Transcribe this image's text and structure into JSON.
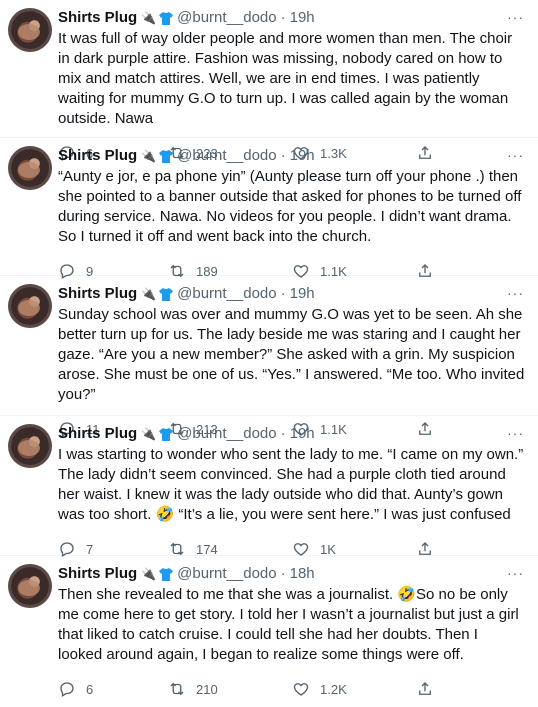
{
  "tweets": [
    {
      "name": "Shirts Plug",
      "emoji": "🔌",
      "handle": "@burnt__dodo",
      "time": "19h",
      "text": "It was full of way older people and more women than men. The choir in dark purple attire. Fashion was missing, nobody cared on how to mix and match attires. Well, we are in end times. I was patiently waiting for mummy G.O to turn up. I was called again by the woman outside. Nawa",
      "replies": "6",
      "retweets": "223",
      "likes": "1.3K"
    },
    {
      "name": "Shirts Plug",
      "emoji": "🔌",
      "handle": "@burnt__dodo",
      "time": "19h",
      "text": "“Aunty e jor, e pa phone yin” (Aunty please turn off your phone .) then she pointed to a banner outside that asked for phones to be turned off during service. Nawa. No videos for you people. I didn’t want drama. So I turned it off and went back into the church.",
      "replies": "9",
      "retweets": "189",
      "likes": "1.1K"
    },
    {
      "name": "Shirts Plug",
      "emoji": "🔌",
      "handle": "@burnt__dodo",
      "time": "19h",
      "text": "Sunday school was over and mummy G.O was yet to be seen. Ah she better turn up for us. The lady beside me was staring and I caught her gaze. “Are you a new member?” She asked with a grin. My suspicion arose. She must be one of us. “Yes.” I answered. “Me too. Who invited you?”",
      "replies": "11",
      "retweets": "213",
      "likes": "1.1K"
    },
    {
      "name": "Shirts Plug",
      "emoji": "🔌",
      "handle": "@burnt__dodo",
      "time": "19h",
      "text": "I was starting to wonder who sent the lady to me. “I came on my own.” The lady didn’t seem convinced. She had a purple cloth tied around her waist. I knew it was the lady outside who did that. Aunty’s gown was too short. 🤣 “It’s a lie, you were sent here.” I was just confused",
      "replies": "7",
      "retweets": "174",
      "likes": "1K"
    },
    {
      "name": "Shirts Plug",
      "emoji": "🔌",
      "handle": "@burnt__dodo",
      "time": "18h",
      "text": "Then she revealed to me that she was a journalist. 🤣So no be only me come here to get story. I told her I wasn’t a journalist but just a girl that liked to catch cruise. I could tell she had her doubts. Then I looked around again, I began to realize some things were off.",
      "replies": "6",
      "retweets": "210",
      "likes": "1.2K"
    }
  ],
  "icons": {
    "reply": "reply-icon",
    "retweet": "retweet-icon",
    "like": "heart-icon",
    "share": "share-icon",
    "more": "more-icon",
    "shirt": "shirt-icon",
    "plug": "plug-icon"
  },
  "colors": {
    "text": "#0f1419",
    "muted": "#536471",
    "divider": "#eff3f4",
    "shirt": "#1d9bf0"
  },
  "more_label": "···"
}
